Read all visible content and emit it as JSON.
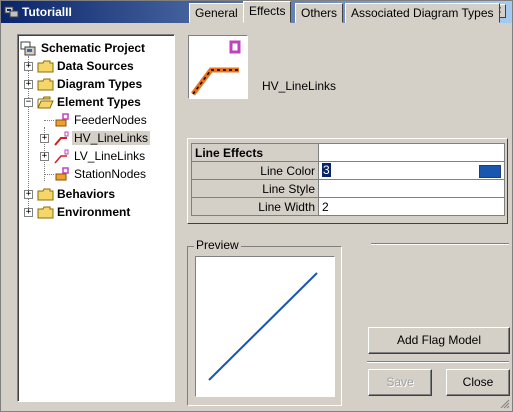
{
  "window": {
    "title": "TutorialII",
    "minimize_glyph": "_",
    "maximize_glyph": "□",
    "close_glyph": "×"
  },
  "tree": {
    "root": "Schematic Project",
    "items": [
      {
        "label": "Data Sources"
      },
      {
        "label": "Diagram Types"
      },
      {
        "label": "Element Types"
      },
      {
        "label": "FeederNodes"
      },
      {
        "label": "HV_LineLinks"
      },
      {
        "label": "LV_LineLinks"
      },
      {
        "label": "StationNodes"
      },
      {
        "label": "Behaviors"
      },
      {
        "label": "Environment"
      }
    ],
    "expanded_glyph": "−",
    "collapsed_glyph": "+"
  },
  "header": {
    "element_name": "HV_LineLinks"
  },
  "tabs": [
    "General",
    "Effects",
    "Others",
    "Associated Diagram Types"
  ],
  "active_tab": "Effects",
  "properties": {
    "group": "Line Effects",
    "rows": [
      {
        "key": "Line Color",
        "value": "3"
      },
      {
        "key": "Line Style",
        "value": ""
      },
      {
        "key": "Line Width",
        "value": "2"
      }
    ],
    "line_color_hex": "#1a56b0"
  },
  "preview": {
    "legend": "Preview"
  },
  "buttons": {
    "add_flag": "Add Flag Model",
    "save": "Save",
    "close": "Close"
  },
  "colors": {
    "titlebar_start": "#0a246a",
    "titlebar_end": "#a6caf0",
    "face": "#d4d0c8",
    "hv_line_orange": "#e8731e",
    "hv_icon_magenta": "#c040c0",
    "preview_line": "#1a56b0"
  }
}
